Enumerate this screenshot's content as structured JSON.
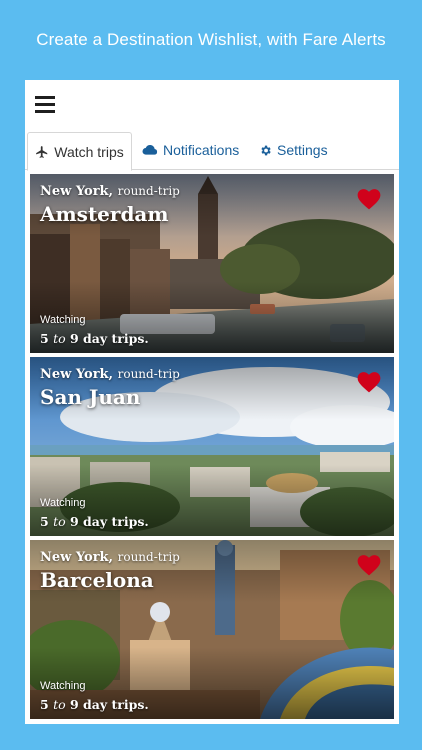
{
  "headline": "Create a Destination Wishlist, with Fare Alerts",
  "tabs": [
    {
      "label": "Watch trips",
      "icon": "airplane-icon"
    },
    {
      "label": "Notifications",
      "icon": "cloud-icon"
    },
    {
      "label": "Settings",
      "icon": "gear-icon"
    }
  ],
  "colors": {
    "background": "#5bbcf0",
    "tab_text": "#1a5f9a",
    "heart": "#d0021b"
  },
  "trips": [
    {
      "origin": "New York,",
      "trip_type": "round-trip",
      "destination": "Amsterdam",
      "watching": "Watching",
      "min": "5",
      "to": "to",
      "max": "9 day trips.",
      "favorite": true
    },
    {
      "origin": "New York,",
      "trip_type": "round-trip",
      "destination": "San Juan",
      "watching": "Watching",
      "min": "5",
      "to": "to",
      "max": "9 day trips.",
      "favorite": true
    },
    {
      "origin": "New York,",
      "trip_type": "round-trip",
      "destination": "Barcelona",
      "watching": "Watching",
      "min": "5",
      "to": "to",
      "max": "9 day trips.",
      "favorite": true
    }
  ]
}
